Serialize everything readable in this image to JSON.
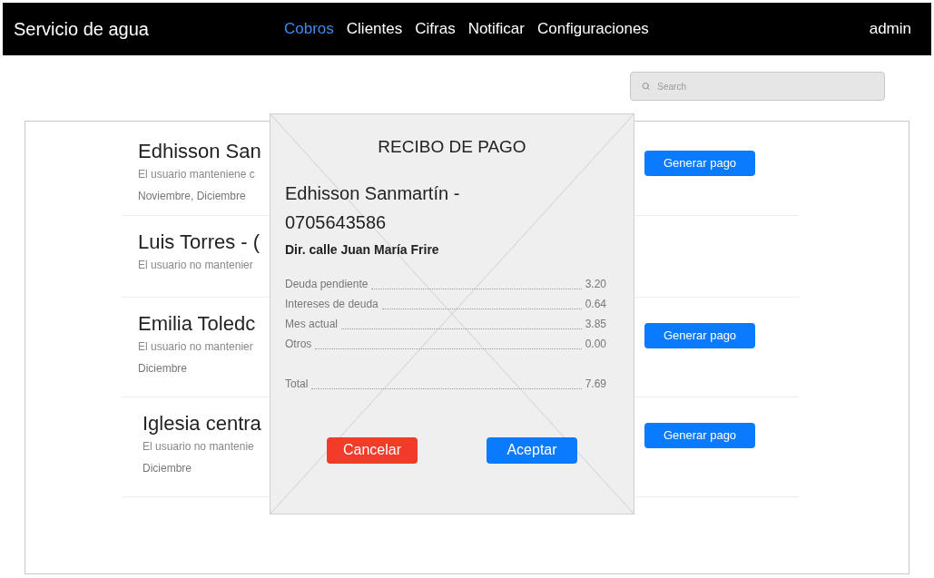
{
  "navbar": {
    "brand": "Servicio de agua",
    "links": [
      {
        "label": "Cobros",
        "selected": true
      },
      {
        "label": "Clientes",
        "selected": false
      },
      {
        "label": "Cifras",
        "selected": false
      },
      {
        "label": "Notificar",
        "selected": false
      },
      {
        "label": "Configuraciones",
        "selected": false
      }
    ],
    "user": "admin"
  },
  "search": {
    "placeholder": "Search"
  },
  "clients": [
    {
      "name": "Edhisson San",
      "detail": "El usuario manteniene c",
      "months": "Noviembre, Diciembre",
      "action": "Generar pago"
    },
    {
      "name": "Luis Torres - (",
      "detail": "El usuario no mantenier"
    },
    {
      "name": "Emilia Toledc",
      "detail": "El usuario no mantenier",
      "months": "Diciembre",
      "action": "Generar pago"
    },
    {
      "name": "Iglesia centra",
      "detail": "El usuario no mantenie",
      "months": "Diciembre",
      "action": "Generar pago"
    }
  ],
  "receipt": {
    "title": "RECIBO DE PAGO",
    "client": "Edhisson Sanmartín - 0705643586",
    "address": "Dir. calle Juan María Frire",
    "lines": [
      {
        "label": "Deuda pendiente",
        "amount": "3.20"
      },
      {
        "label": "Intereses de deuda",
        "amount": "0.64"
      },
      {
        "label": "Mes actual",
        "amount": "3.85"
      },
      {
        "label": "Otros",
        "amount": "0.00"
      }
    ],
    "total": {
      "label": "Total",
      "amount": "7.69"
    },
    "buttons": [
      {
        "label": "Cancelar",
        "kind": "danger"
      },
      {
        "label": "Aceptar",
        "kind": "primary"
      }
    ]
  }
}
